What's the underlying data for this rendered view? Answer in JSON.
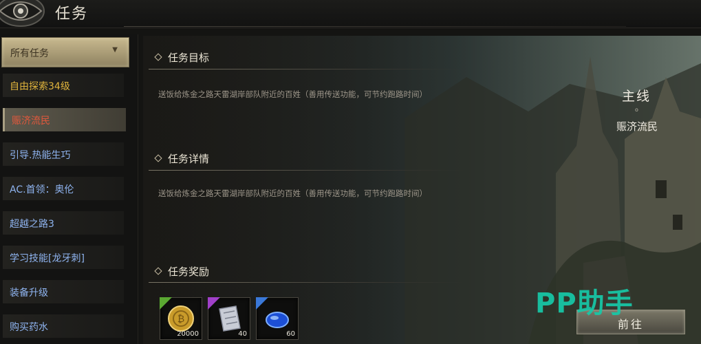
{
  "header": {
    "title": "任务"
  },
  "sidebar": {
    "filter_label": "所有任务",
    "items": [
      {
        "label": "自由探索34级",
        "style": "gold"
      },
      {
        "label": "赈济流民",
        "style": "active"
      },
      {
        "label": "引导.热能生巧",
        "style": "blue"
      },
      {
        "label": "AC.首领：奥伦",
        "style": "blue"
      },
      {
        "label": "超越之路3",
        "style": "blue"
      },
      {
        "label": "学习技能[龙牙刺]",
        "style": "blue"
      },
      {
        "label": "装备升级",
        "style": "blue"
      },
      {
        "label": "购买药水",
        "style": "blue"
      }
    ]
  },
  "detail": {
    "objective_heading": "任务目标",
    "objective_text": "送饭给炼金之路天雷湖岸部队附近的百姓（善用传送功能，可节约跑路时间）",
    "details_heading": "任务详情",
    "details_text": "送饭给炼金之路天雷湖岸部队附近的百姓（善用传送功能，可节约跑路时间）",
    "rewards_heading": "任务奖励",
    "quest_type": "主线",
    "quest_dot": "o",
    "quest_name": "赈济流民",
    "rewards": [
      {
        "icon": "gold-coin-icon",
        "count": "20000",
        "tier_color": "#5aa832"
      },
      {
        "icon": "scroll-shard-icon",
        "count": "40",
        "tier_color": "#a040c8"
      },
      {
        "icon": "blue-gem-icon",
        "count": "60",
        "tier_color": "#3a78d8"
      }
    ],
    "go_button_label": "前往"
  },
  "watermark": "PP助手",
  "colors": {
    "gold_text": "#e0b43c",
    "active_text": "#e0583c",
    "blue_text": "#8fb4f0",
    "watermark": "#17c9a8"
  }
}
